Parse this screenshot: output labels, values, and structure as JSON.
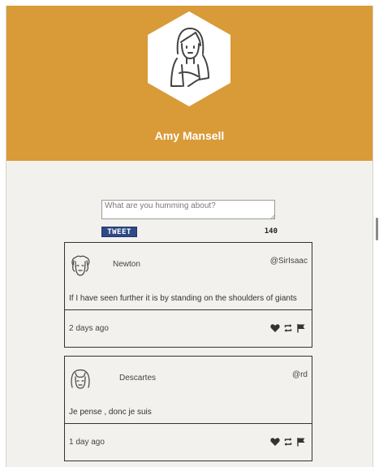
{
  "profile": {
    "name": "Amy Mansell",
    "avatar_icon": "user-portrait-icon"
  },
  "compose": {
    "placeholder": "What are you humming about?",
    "button_label": "TWEET",
    "char_count": "140"
  },
  "colors": {
    "header": "#d99a38",
    "button": "#2f4a86",
    "page": "#f3f1ed"
  },
  "tweets": [
    {
      "author": "Newton",
      "handle": "@SirIsaac",
      "text": "If I have seen further it is by standing on the shoulders of giants",
      "time": "2 days ago"
    },
    {
      "author": "Descartes",
      "handle": "@rd",
      "text": "Je pense , donc je suis",
      "time": "1 day ago"
    }
  ],
  "action_icons": [
    "heart-icon",
    "retweet-icon",
    "flag-icon"
  ]
}
